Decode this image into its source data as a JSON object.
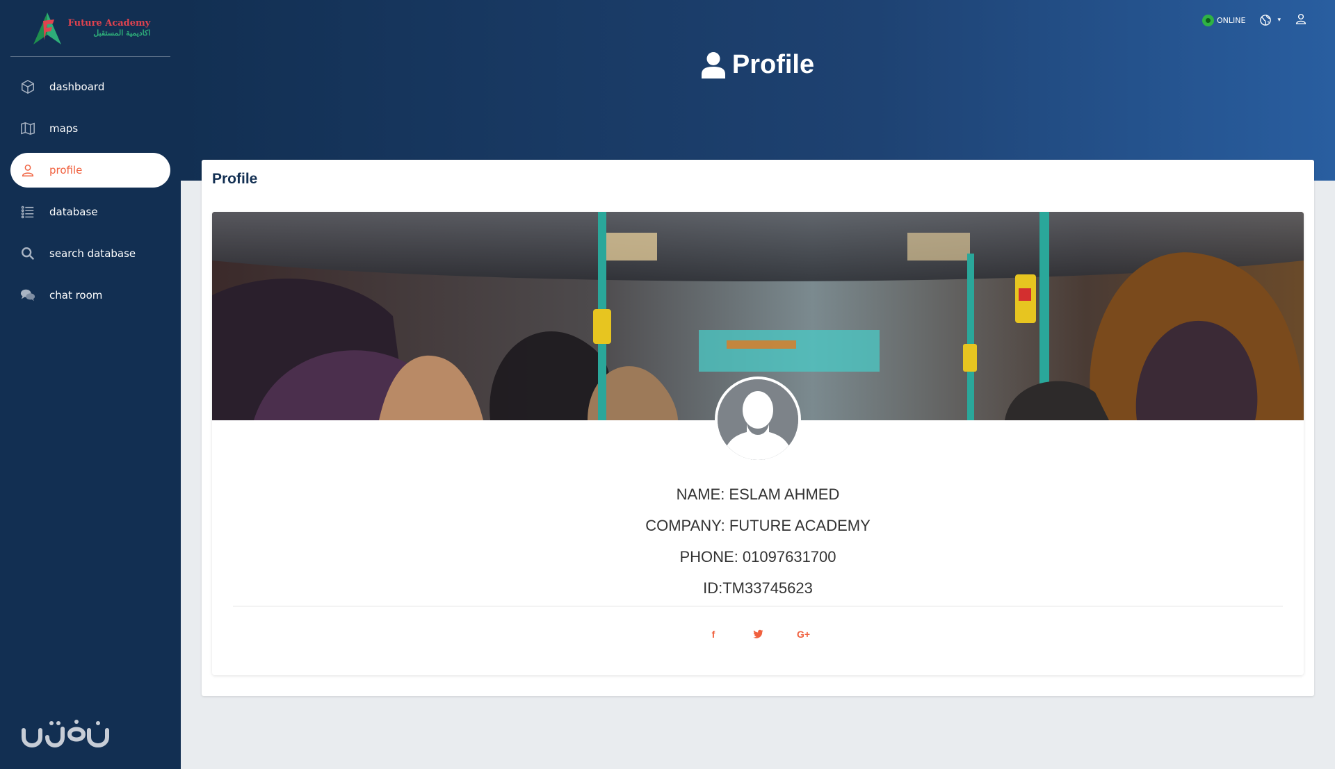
{
  "brand": {
    "name_en": "Future Academy",
    "name_ar": "اكاديمية المستقبل"
  },
  "sidebar": {
    "items": [
      {
        "label": "dashboard",
        "icon": "cube-icon",
        "active": false
      },
      {
        "label": "maps",
        "icon": "map-icon",
        "active": false
      },
      {
        "label": "profile",
        "icon": "user-icon",
        "active": true
      },
      {
        "label": "database",
        "icon": "list-icon",
        "active": false
      },
      {
        "label": "search database",
        "icon": "search-icon",
        "active": false
      },
      {
        "label": "chat room",
        "icon": "chat-icon",
        "active": false
      }
    ]
  },
  "header": {
    "title": "Profile",
    "status": "ONLINE",
    "status_color": "#2fb344"
  },
  "card": {
    "title": "Profile"
  },
  "profile": {
    "name": "NAME: ESLAM AHMED",
    "company": "COMPANY: FUTURE ACADEMY",
    "phone": "PHONE: 01097631700",
    "id": "ID:TM33745623"
  },
  "social": {
    "facebook": "f",
    "twitter": "t",
    "google": "G+"
  },
  "colors": {
    "sidebar_bg": "#122f52",
    "accent": "#f0603e",
    "header_gradient_end": "#295ea0"
  }
}
